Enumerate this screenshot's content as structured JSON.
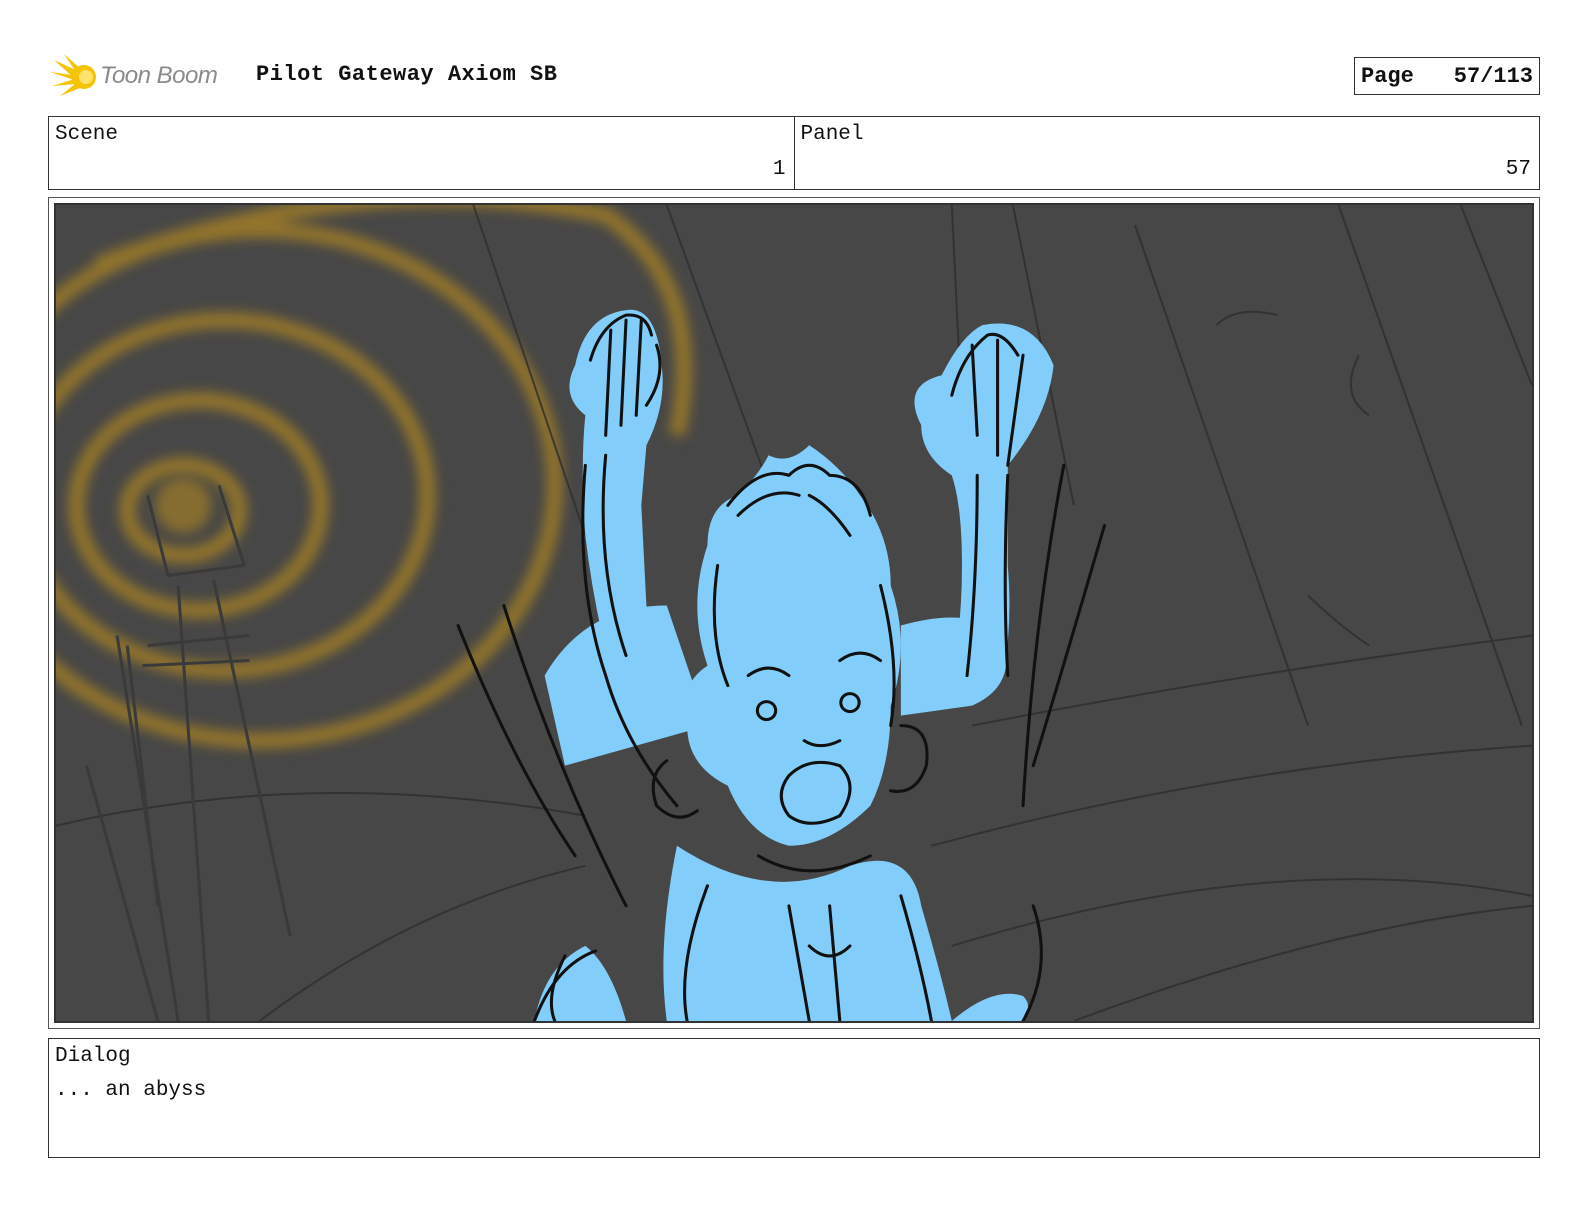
{
  "header": {
    "logo_text": "Toon Boom",
    "title": "Pilot Gateway Axiom SB",
    "page_label": "Page",
    "page_number": "57/113"
  },
  "info": {
    "scene_label": "Scene",
    "scene_value": "1",
    "panel_label": "Panel",
    "panel_value": "57"
  },
  "panel_image": {
    "background_color": "#474747",
    "character_color": "#82cdfa",
    "glow_color": "#a07d28"
  },
  "dialog": {
    "label": "Dialog",
    "text": "... an abyss"
  }
}
